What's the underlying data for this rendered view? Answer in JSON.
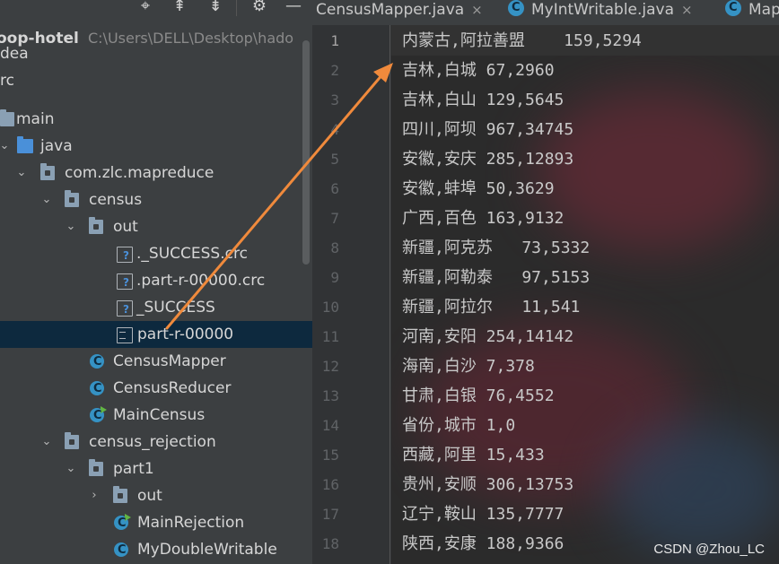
{
  "project": {
    "name": "oop-hotel",
    "path": "C:\\Users\\DELL\\Desktop\\hado"
  },
  "toolbar": {
    "icons": [
      "target-icon",
      "expand-all-icon",
      "collapse-all-icon",
      "gear-icon",
      "minimize-icon"
    ]
  },
  "tree": [
    {
      "label": "dea"
    },
    {
      "label": "rc"
    },
    {
      "label": "main"
    },
    {
      "label": "java"
    },
    {
      "label": "com.zlc.mapreduce"
    },
    {
      "label": "census"
    },
    {
      "label": "out"
    },
    {
      "label": "._SUCCESS.crc"
    },
    {
      "label": ".part-r-00000.crc"
    },
    {
      "label": "_SUCCESS"
    },
    {
      "label": "part-r-00000"
    },
    {
      "label": "CensusMapper"
    },
    {
      "label": "CensusReducer"
    },
    {
      "label": "MainCensus"
    },
    {
      "label": "census_rejection"
    },
    {
      "label": "part1"
    },
    {
      "label": "out"
    },
    {
      "label": "MainRejection"
    },
    {
      "label": "MyDoubleWritable"
    }
  ],
  "tabs": [
    {
      "label": "CensusMapper.java",
      "close": "×"
    },
    {
      "label": "MyIntWritable.java",
      "close": "×"
    },
    {
      "label": "Map"
    }
  ],
  "editor": {
    "lines": [
      {
        "num": "1",
        "text": "内蒙古,阿拉善盟    159,5294"
      },
      {
        "num": "2",
        "text": "吉林,白城 67,2960"
      },
      {
        "num": "3",
        "text": "吉林,白山 129,5645"
      },
      {
        "num": "4",
        "text": "四川,阿坝 967,34745"
      },
      {
        "num": "5",
        "text": "安徽,安庆 285,12893"
      },
      {
        "num": "6",
        "text": "安徽,蚌埠 50,3629"
      },
      {
        "num": "7",
        "text": "广西,百色 163,9132"
      },
      {
        "num": "8",
        "text": "新疆,阿克苏   73,5332"
      },
      {
        "num": "9",
        "text": "新疆,阿勒泰   97,5153"
      },
      {
        "num": "10",
        "text": "新疆,阿拉尔   11,541"
      },
      {
        "num": "11",
        "text": "河南,安阳 254,14142"
      },
      {
        "num": "12",
        "text": "海南,白沙 7,378"
      },
      {
        "num": "13",
        "text": "甘肃,白银 76,4552"
      },
      {
        "num": "14",
        "text": "省份,城市 1,0"
      },
      {
        "num": "15",
        "text": "西藏,阿里 15,433"
      },
      {
        "num": "16",
        "text": "贵州,安顺 306,13753"
      },
      {
        "num": "17",
        "text": "辽宁,鞍山 135,7777"
      },
      {
        "num": "18",
        "text": "陕西,安康 188,9366"
      }
    ]
  },
  "watermark": "CSDN @Zhou_LC",
  "colors": {
    "arrow": "#f08a3c",
    "selection": "#0d293e",
    "class_icon": "#3592c4"
  }
}
